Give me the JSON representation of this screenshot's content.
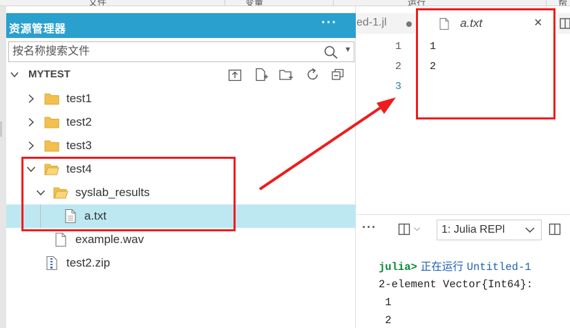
{
  "menubar": {
    "items": [
      "文件",
      "变量",
      "运行",
      "帮"
    ]
  },
  "explorer": {
    "title": "资源管理器",
    "more": "···",
    "search": {
      "placeholder": "按名称搜索文件"
    },
    "folder_name": "MYTEST",
    "tree": [
      {
        "name": "test1",
        "type": "folder",
        "expanded": false
      },
      {
        "name": "test2",
        "type": "folder",
        "expanded": false
      },
      {
        "name": "test3",
        "type": "folder",
        "expanded": false
      },
      {
        "name": "test4",
        "type": "folder",
        "expanded": true
      },
      {
        "name": "syslab_results",
        "type": "folder",
        "expanded": true
      },
      {
        "name": "a.txt",
        "type": "file",
        "selected": true
      },
      {
        "name": "example.wav",
        "type": "file"
      },
      {
        "name": "test2.zip",
        "type": "zip"
      }
    ]
  },
  "editor": {
    "tabs": [
      {
        "label": "ed-1.jl",
        "modified": true
      },
      {
        "label": "a.txt",
        "active": true,
        "close": "×"
      }
    ],
    "lines": [
      {
        "num": "1",
        "text": "1"
      },
      {
        "num": "2",
        "text": "2"
      },
      {
        "num": "3",
        "text": ""
      }
    ]
  },
  "panel": {
    "more": "···",
    "terminal_select": "1: Julia REPl"
  },
  "terminal": {
    "prompt": "julia>",
    "running_text": " 正在运行 ",
    "running_file": "Untitled-1",
    "lines": [
      "2-element Vector{Int64}:",
      " 1",
      " 2"
    ]
  },
  "colors": {
    "header_bg": "#2aa0cf",
    "selection_bg": "#bde8f2",
    "annotation": "#ee1c1c",
    "prompt": "#0a8a3a"
  }
}
